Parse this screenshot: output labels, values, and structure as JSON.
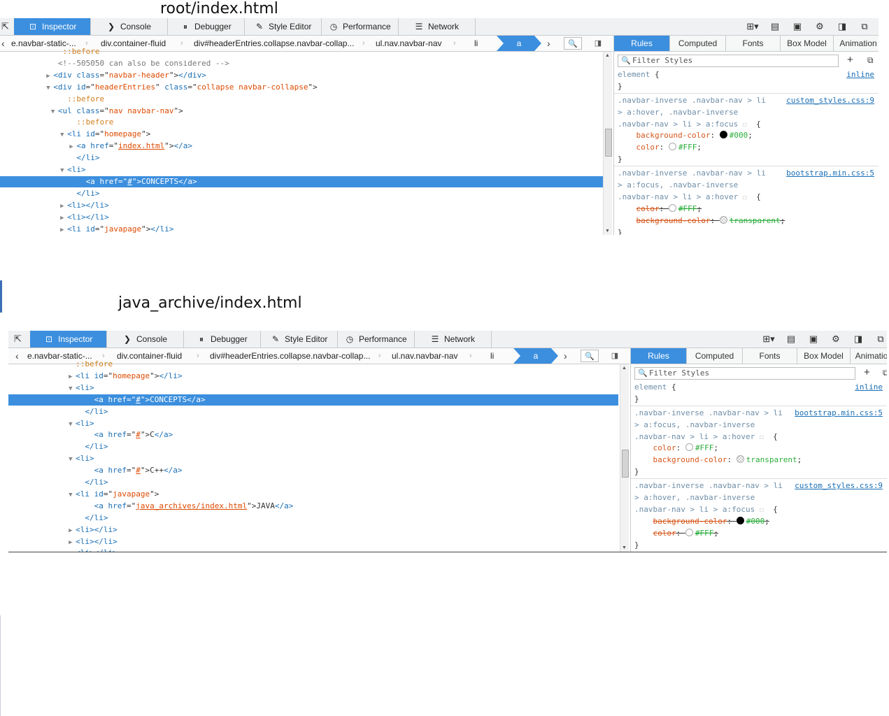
{
  "captions": {
    "top": "root/index.html",
    "bottom": "java_archive/index.html"
  },
  "tools": {
    "inspector": "Inspector",
    "console": "Console",
    "debugger": "Debugger",
    "style_editor": "Style Editor",
    "performance": "Performance",
    "network": "Network"
  },
  "breadcrumbs": {
    "prev": "e.navbar-static-...",
    "container": "div.container-fluid",
    "header": "div#headerEntries.collapse.navbar-collap...",
    "ul": "ul.nav.navbar-nav",
    "li": "li",
    "a": "a"
  },
  "sidebar_tabs": {
    "rules": "Rules",
    "computed": "Computed",
    "fonts": "Fonts",
    "box_model": "Box Model",
    "animations_top": "Animation",
    "animations_bottom": "Animatio"
  },
  "filter_placeholder": "Filter Styles",
  "panel_top": {
    "markup": [
      {
        "pre": "            ",
        "tw": "",
        "parts": [
          [
            "pse",
            "::before"
          ]
        ]
      },
      {
        "pre": "           ",
        "tw": "",
        "parts": [
          [
            "cmt",
            "<!--505050 can also be considered -->"
          ]
        ]
      },
      {
        "pre": "          ",
        "tw": "▶",
        "parts": [
          [
            "tag",
            "<div "
          ],
          [
            "atn",
            "class"
          ],
          [
            "txt",
            "=\""
          ],
          [
            "atv",
            "navbar-header"
          ],
          [
            "txt",
            "\">"
          ],
          [
            "tag",
            "</div>"
          ]
        ]
      },
      {
        "pre": "          ",
        "tw": "▼",
        "parts": [
          [
            "tag",
            "<div "
          ],
          [
            "atn",
            "id"
          ],
          [
            "txt",
            "=\""
          ],
          [
            "atv",
            "headerEntries"
          ],
          [
            "txt",
            "\" "
          ],
          [
            "atn",
            "class"
          ],
          [
            "txt",
            "=\""
          ],
          [
            "atv",
            "collapse navbar-collapse"
          ],
          [
            "txt",
            "\">"
          ]
        ]
      },
      {
        "pre": "             ",
        "tw": "",
        "parts": [
          [
            "pse",
            "::before"
          ]
        ]
      },
      {
        "pre": "           ",
        "tw": "▼",
        "parts": [
          [
            "tag",
            "<ul "
          ],
          [
            "atn",
            "class"
          ],
          [
            "txt",
            "=\""
          ],
          [
            "atv",
            "nav navbar-nav"
          ],
          [
            "txt",
            "\">"
          ]
        ]
      },
      {
        "pre": "               ",
        "tw": "",
        "parts": [
          [
            "pse",
            "::before"
          ]
        ]
      },
      {
        "pre": "             ",
        "tw": "▼",
        "parts": [
          [
            "tag",
            "<li "
          ],
          [
            "atn",
            "id"
          ],
          [
            "txt",
            "=\""
          ],
          [
            "atv",
            "homepage"
          ],
          [
            "txt",
            "\">"
          ]
        ]
      },
      {
        "pre": "               ",
        "tw": "▶",
        "parts": [
          [
            "tag",
            "<a "
          ],
          [
            "atn",
            "href"
          ],
          [
            "txt",
            "=\""
          ],
          [
            "lnk",
            "index.html"
          ],
          [
            "txt",
            "\">"
          ],
          [
            "tag",
            "</a>"
          ]
        ]
      },
      {
        "pre": "               ",
        "tw": "",
        "parts": [
          [
            "tag",
            "</li>"
          ]
        ]
      },
      {
        "pre": "             ",
        "tw": "▼",
        "parts": [
          [
            "tag",
            "<li>"
          ]
        ]
      },
      {
        "pre": "                 ",
        "tw": "",
        "sel": true,
        "parts": [
          [
            "tag",
            "<a "
          ],
          [
            "atn",
            "href"
          ],
          [
            "txt",
            "=\""
          ],
          [
            "lnk",
            "#"
          ],
          [
            "txt",
            "\">CONCEPTS"
          ],
          [
            "tag",
            "</a>"
          ]
        ]
      },
      {
        "pre": "               ",
        "tw": "",
        "parts": [
          [
            "tag",
            "</li>"
          ]
        ]
      },
      {
        "pre": "             ",
        "tw": "▶",
        "parts": [
          [
            "tag",
            "<li></li>"
          ]
        ]
      },
      {
        "pre": "             ",
        "tw": "▶",
        "parts": [
          [
            "tag",
            "<li></li>"
          ]
        ]
      },
      {
        "pre": "             ",
        "tw": "▶",
        "parts": [
          [
            "tag",
            "<li "
          ],
          [
            "atn",
            "id"
          ],
          [
            "txt",
            "=\""
          ],
          [
            "atv",
            "javapage"
          ],
          [
            "txt",
            "\">"
          ],
          [
            "tag",
            "</li>"
          ]
        ]
      }
    ],
    "rules": [
      {
        "lines": [
          [
            [
              "sel-c",
              "element "
            ],
            [
              "txt",
              "{"
            ]
          ],
          [
            [
              "txt",
              "}"
            ]
          ]
        ],
        "src": "inline"
      },
      {
        "lines": [
          [
            [
              "sel-c",
              ".navbar-inverse .navbar-nav > li"
            ]
          ],
          [
            [
              "sel-c",
              "> a:hover, .navbar-inverse"
            ]
          ],
          [
            [
              "sel-c",
              ".navbar-nav > li > a:focus "
            ],
            [
              "pin",
              "☐"
            ],
            [
              "txt",
              "  {"
            ]
          ],
          [
            [
              "txt",
              "    "
            ],
            [
              "pn",
              "background-color"
            ],
            [
              "txt",
              ": "
            ],
            [
              "swf",
              "#000"
            ],
            [
              "pv",
              "#000"
            ],
            [
              "txt",
              ";"
            ]
          ],
          [
            [
              "txt",
              "    "
            ],
            [
              "pn",
              "color"
            ],
            [
              "txt",
              ": "
            ],
            [
              "swo",
              ""
            ],
            [
              "pv",
              "#FFF"
            ],
            [
              "txt",
              ";"
            ]
          ],
          [
            [
              "txt",
              "}"
            ]
          ]
        ],
        "src": "custom_styles.css:9"
      },
      {
        "lines": [
          [
            [
              "sel-c",
              ".navbar-inverse .navbar-nav > li"
            ]
          ],
          [
            [
              "sel-c",
              "> a:focus, .navbar-inverse"
            ]
          ],
          [
            [
              "sel-c",
              ".navbar-nav > li > a:hover "
            ],
            [
              "pin",
              "☐"
            ],
            [
              "txt",
              "  {"
            ]
          ],
          [
            [
              "txt",
              "    "
            ],
            [
              "spn",
              "color"
            ],
            [
              "stx",
              ": "
            ],
            [
              "swo",
              ""
            ],
            [
              "spv",
              "#FFF"
            ],
            [
              "stx",
              ";"
            ]
          ],
          [
            [
              "txt",
              "    "
            ],
            [
              "spn",
              "background-color"
            ],
            [
              "stx",
              ": "
            ],
            [
              "swt",
              ""
            ],
            [
              "spv",
              "transparent"
            ],
            [
              "stx",
              ";"
            ]
          ],
          [
            [
              "txt",
              "}"
            ]
          ]
        ],
        "src": "bootstrap.min.css:5"
      }
    ]
  },
  "panel_bottom": {
    "markup": [
      {
        "pre": "             ",
        "tw": "",
        "parts": [
          [
            "pse",
            "::before"
          ]
        ]
      },
      {
        "pre": "             ",
        "tw": "▶",
        "parts": [
          [
            "tag",
            "<li "
          ],
          [
            "atn",
            "id"
          ],
          [
            "txt",
            "=\""
          ],
          [
            "atv",
            "homepage"
          ],
          [
            "txt",
            "\">"
          ],
          [
            "tag",
            "</li>"
          ]
        ]
      },
      {
        "pre": "             ",
        "tw": "▼",
        "parts": [
          [
            "tag",
            "<li>"
          ]
        ]
      },
      {
        "pre": "                 ",
        "tw": "",
        "sel": true,
        "parts": [
          [
            "tag",
            "<a "
          ],
          [
            "atn",
            "href"
          ],
          [
            "txt",
            "=\""
          ],
          [
            "lnk",
            "#"
          ],
          [
            "txt",
            "\">CONCEPTS"
          ],
          [
            "tag",
            "</a>"
          ]
        ]
      },
      {
        "pre": "               ",
        "tw": "",
        "parts": [
          [
            "tag",
            "</li>"
          ]
        ]
      },
      {
        "pre": "             ",
        "tw": "▼",
        "parts": [
          [
            "tag",
            "<li>"
          ]
        ]
      },
      {
        "pre": "                 ",
        "tw": "",
        "parts": [
          [
            "tag",
            "<a "
          ],
          [
            "atn",
            "href"
          ],
          [
            "txt",
            "=\""
          ],
          [
            "lnk",
            "#"
          ],
          [
            "txt",
            "\">C"
          ],
          [
            "tag",
            "</a>"
          ]
        ]
      },
      {
        "pre": "               ",
        "tw": "",
        "parts": [
          [
            "tag",
            "</li>"
          ]
        ]
      },
      {
        "pre": "             ",
        "tw": "▼",
        "parts": [
          [
            "tag",
            "<li>"
          ]
        ]
      },
      {
        "pre": "                 ",
        "tw": "",
        "parts": [
          [
            "tag",
            "<a "
          ],
          [
            "atn",
            "href"
          ],
          [
            "txt",
            "=\""
          ],
          [
            "lnk",
            "#"
          ],
          [
            "txt",
            "\">C++"
          ],
          [
            "tag",
            "</a>"
          ]
        ]
      },
      {
        "pre": "               ",
        "tw": "",
        "parts": [
          [
            "tag",
            "</li>"
          ]
        ]
      },
      {
        "pre": "             ",
        "tw": "▼",
        "parts": [
          [
            "tag",
            "<li "
          ],
          [
            "atn",
            "id"
          ],
          [
            "txt",
            "=\""
          ],
          [
            "atv",
            "javapage"
          ],
          [
            "txt",
            "\">"
          ]
        ]
      },
      {
        "pre": "                 ",
        "tw": "",
        "parts": [
          [
            "tag",
            "<a "
          ],
          [
            "atn",
            "href"
          ],
          [
            "txt",
            "=\""
          ],
          [
            "lnk",
            "java_archives/index.html"
          ],
          [
            "txt",
            "\">JAVA"
          ],
          [
            "tag",
            "</a>"
          ]
        ]
      },
      {
        "pre": "               ",
        "tw": "",
        "parts": [
          [
            "tag",
            "</li>"
          ]
        ]
      },
      {
        "pre": "             ",
        "tw": "▶",
        "parts": [
          [
            "tag",
            "<li></li>"
          ]
        ]
      },
      {
        "pre": "             ",
        "tw": "▶",
        "parts": [
          [
            "tag",
            "<li></li>"
          ]
        ]
      },
      {
        "pre": "             ",
        "tw": "▶",
        "parts": [
          [
            "tag",
            "<li></li>"
          ]
        ]
      }
    ],
    "rules": [
      {
        "lines": [
          [
            [
              "sel-c",
              "element "
            ],
            [
              "txt",
              "{"
            ]
          ],
          [
            [
              "txt",
              "}"
            ]
          ]
        ],
        "src": "inline"
      },
      {
        "lines": [
          [
            [
              "sel-c",
              ".navbar-inverse .navbar-nav > li"
            ]
          ],
          [
            [
              "sel-c",
              "> a:focus, .navbar-inverse"
            ]
          ],
          [
            [
              "sel-c",
              ".navbar-nav > li > a:hover "
            ],
            [
              "pin",
              "☐"
            ],
            [
              "txt",
              "  {"
            ]
          ],
          [
            [
              "txt",
              "    "
            ],
            [
              "pn",
              "color"
            ],
            [
              "txt",
              ": "
            ],
            [
              "swo",
              ""
            ],
            [
              "pv",
              "#FFF"
            ],
            [
              "txt",
              ";"
            ]
          ],
          [
            [
              "txt",
              "    "
            ],
            [
              "pn",
              "background-color"
            ],
            [
              "txt",
              ": "
            ],
            [
              "swt",
              ""
            ],
            [
              "pv",
              "transparent"
            ],
            [
              "txt",
              ";"
            ]
          ],
          [
            [
              "txt",
              "}"
            ]
          ]
        ],
        "src": "bootstrap.min.css:5"
      },
      {
        "lines": [
          [
            [
              "sel-c",
              ".navbar-inverse .navbar-nav > li"
            ]
          ],
          [
            [
              "sel-c",
              "> a:hover, .navbar-inverse"
            ]
          ],
          [
            [
              "sel-c",
              ".navbar-nav > li > a:focus "
            ],
            [
              "pin",
              "☐"
            ],
            [
              "txt",
              "  {"
            ]
          ],
          [
            [
              "txt",
              "    "
            ],
            [
              "spn",
              "background-color"
            ],
            [
              "stx",
              ": "
            ],
            [
              "swf",
              "#000"
            ],
            [
              "spv",
              "#000"
            ],
            [
              "stx",
              ";"
            ]
          ],
          [
            [
              "txt",
              "    "
            ],
            [
              "spn",
              "color"
            ],
            [
              "stx",
              ": "
            ],
            [
              "swo",
              ""
            ],
            [
              "spv",
              "#FFF"
            ],
            [
              "stx",
              ";"
            ]
          ],
          [
            [
              "txt",
              "}"
            ]
          ]
        ],
        "src": "custom_styles.css:9"
      }
    ]
  }
}
